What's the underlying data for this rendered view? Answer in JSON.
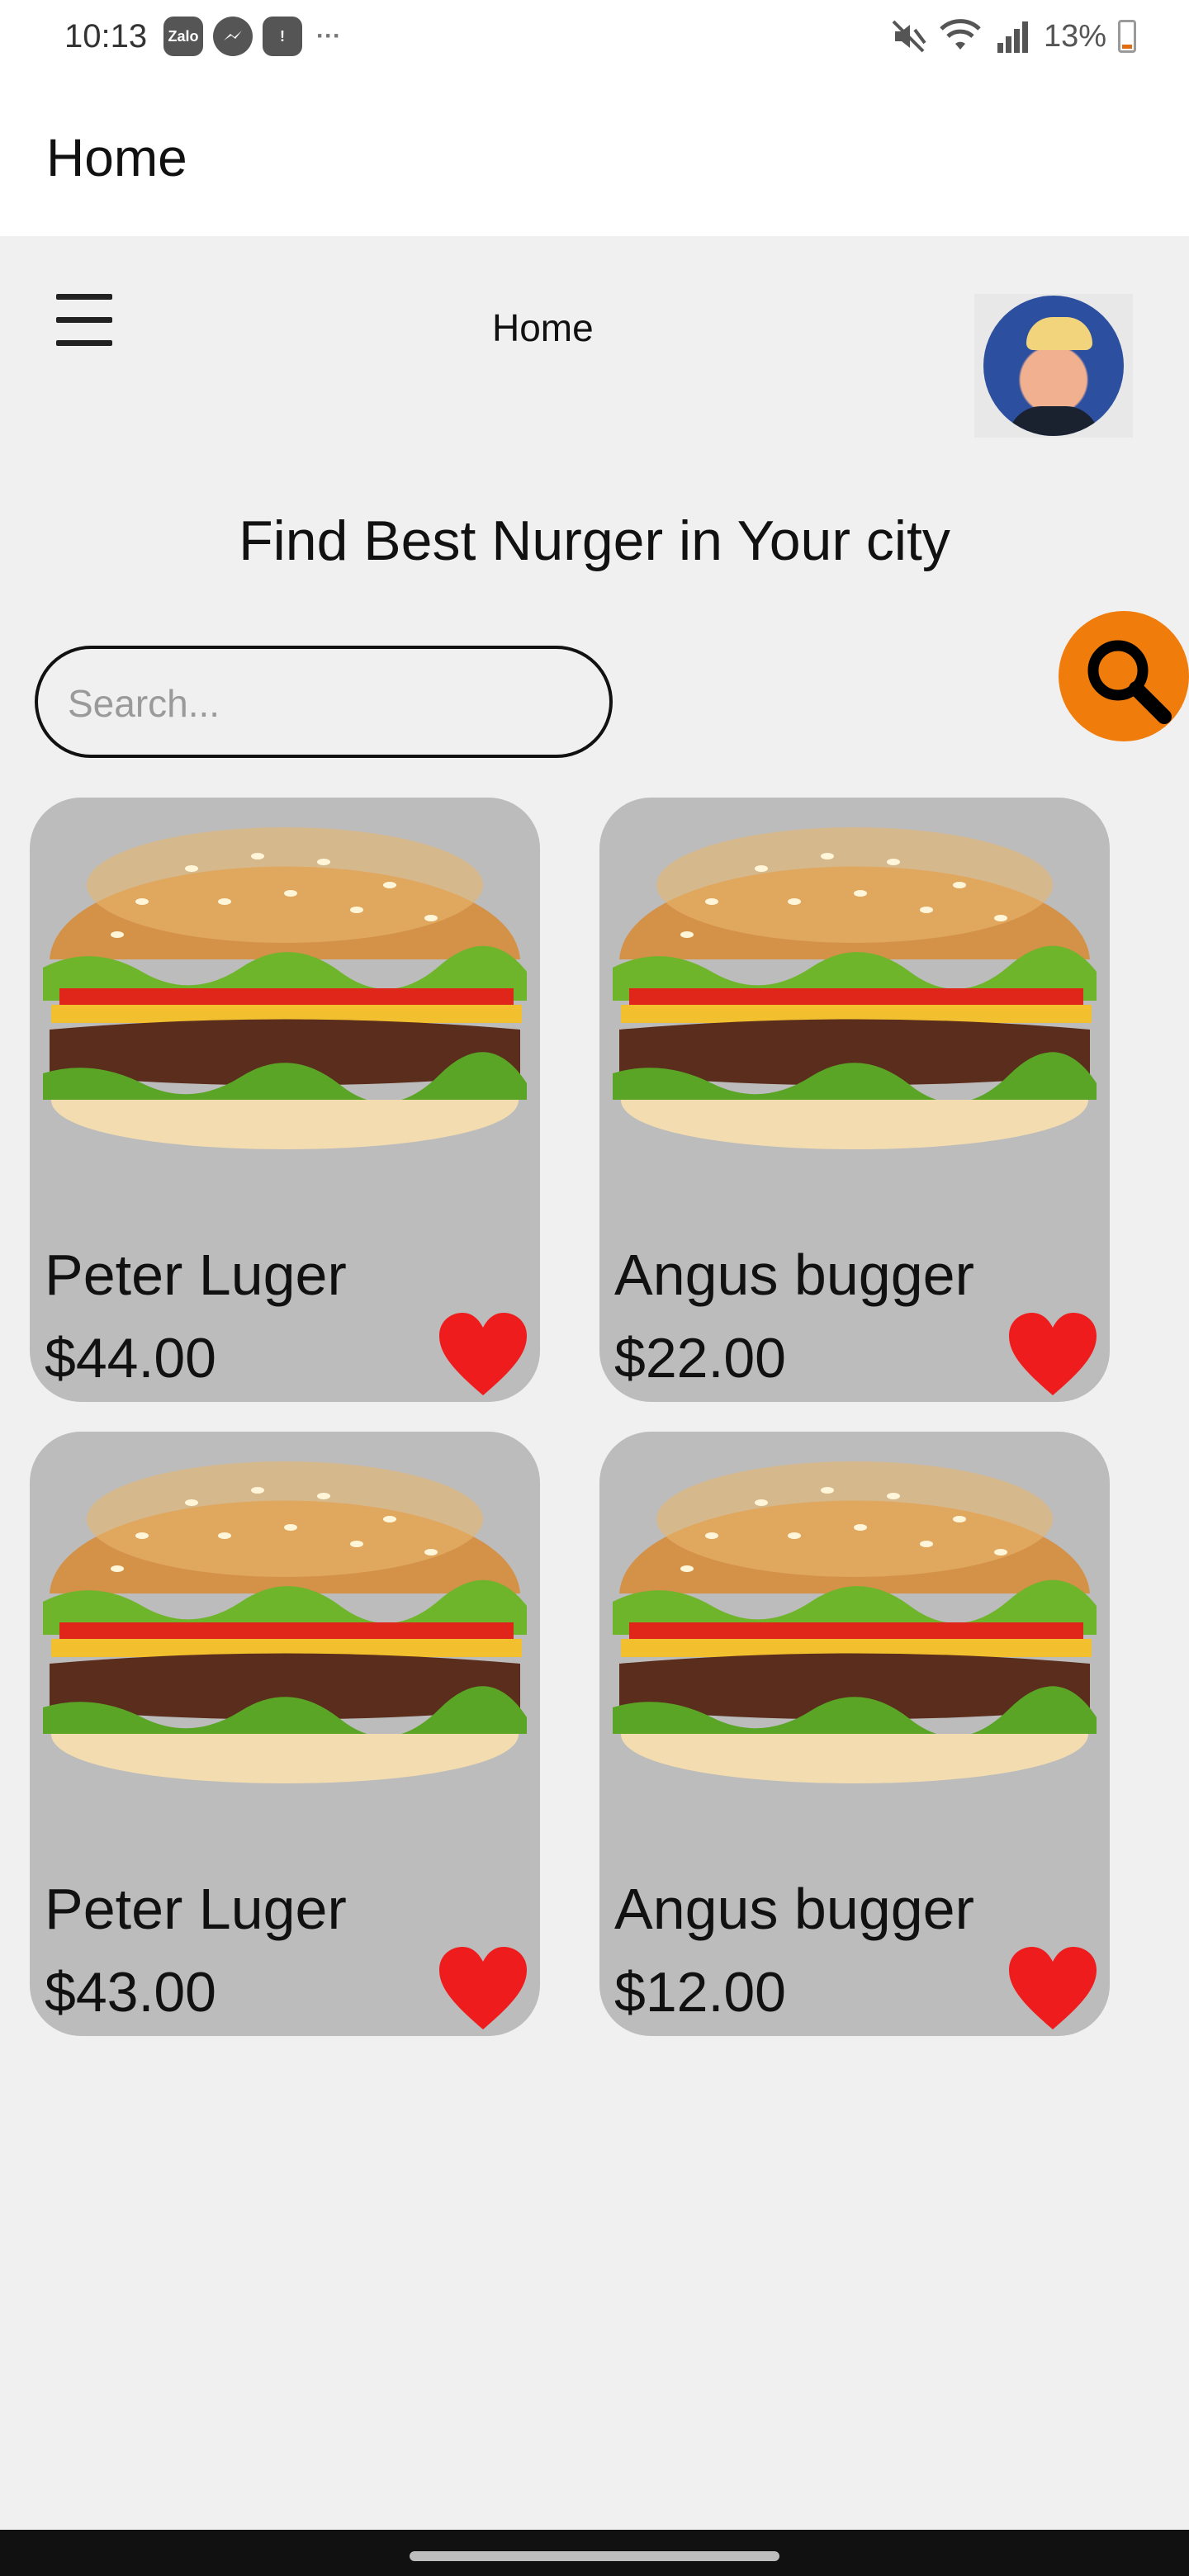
{
  "status_bar": {
    "time": "10:13",
    "left_icons": [
      "zalo-icon",
      "messenger-icon",
      "alert-icon",
      "more-dots-icon"
    ],
    "battery_percent": "13%",
    "right_icons": [
      "mute-icon",
      "wifi-icon",
      "signal-icon",
      "battery-icon"
    ]
  },
  "app_bar": {
    "title": "Home"
  },
  "header": {
    "title": "Home",
    "menu_icon": "hamburger-menu-icon",
    "avatar": "user-avatar"
  },
  "headline": "Find Best Nurger in Your city",
  "search": {
    "placeholder": "Search...",
    "value": "",
    "button_icon": "search-icon"
  },
  "colors": {
    "accent": "#ef7c0b",
    "card": "#bcbcbc",
    "heart": "#ee1c1c",
    "background": "#f0f0f0"
  },
  "products": [
    {
      "name": "Peter Luger",
      "price": "$44.00"
    },
    {
      "name": "Angus bugger",
      "price": "$22.00"
    },
    {
      "name": "Peter Luger",
      "price": "$43.00"
    },
    {
      "name": "Angus bugger",
      "price": "$12.00"
    }
  ]
}
